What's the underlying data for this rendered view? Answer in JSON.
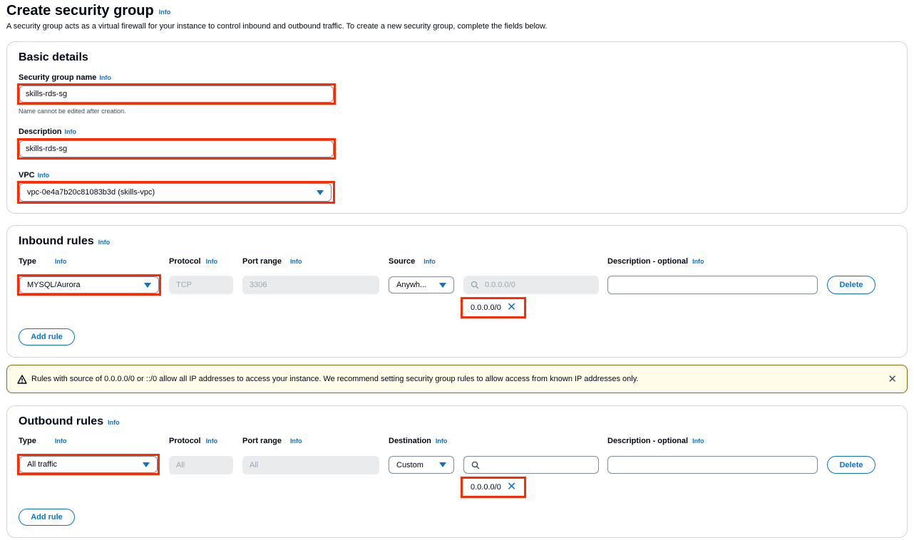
{
  "header": {
    "title": "Create security group",
    "info": "Info",
    "description": "A security group acts as a virtual firewall for your instance to control inbound and outbound traffic. To create a new security group, complete the fields below."
  },
  "basic_details": {
    "title": "Basic details",
    "name_label": "Security group name",
    "name_value": "skills-rds-sg",
    "name_hint": "Name cannot be edited after creation.",
    "desc_label": "Description",
    "desc_value": "skills-rds-sg",
    "vpc_label": "VPC",
    "vpc_value": "vpc-0e4a7b20c81083b3d (skills-vpc)"
  },
  "inbound": {
    "title": "Inbound rules",
    "col_type": "Type",
    "col_protocol": "Protocol",
    "col_port": "Port range",
    "col_source": "Source",
    "col_desc": "Description - optional",
    "type_value": "MYSQL/Aurora",
    "protocol_value": "TCP",
    "port_value": "3306",
    "source_value": "Anywh...",
    "cidr_placeholder": "0.0.0.0/0",
    "token": "0.0.0.0/0",
    "delete": "Delete",
    "add_rule": "Add rule"
  },
  "warning": {
    "text": "Rules with source of 0.0.0.0/0 or ::/0 allow all IP addresses to access your instance. We recommend setting security group rules to allow access from known IP addresses only."
  },
  "outbound": {
    "title": "Outbound rules",
    "col_type": "Type",
    "col_protocol": "Protocol",
    "col_port": "Port range",
    "col_dest": "Destination",
    "col_desc": "Description - optional",
    "type_value": "All traffic",
    "protocol_value": "All",
    "port_value": "All",
    "dest_value": "Custom",
    "token": "0.0.0.0/0",
    "delete": "Delete",
    "add_rule": "Add rule"
  },
  "icons": {
    "info_link": "info-link",
    "dropdown": "chevron-down-icon",
    "search": "search-icon",
    "remove": "close-icon",
    "warning": "warning-icon",
    "dismiss": "close-icon"
  },
  "colors": {
    "accent": "#0972d3",
    "highlight": "#ff2a00",
    "warning_bg": "#fffce9"
  }
}
